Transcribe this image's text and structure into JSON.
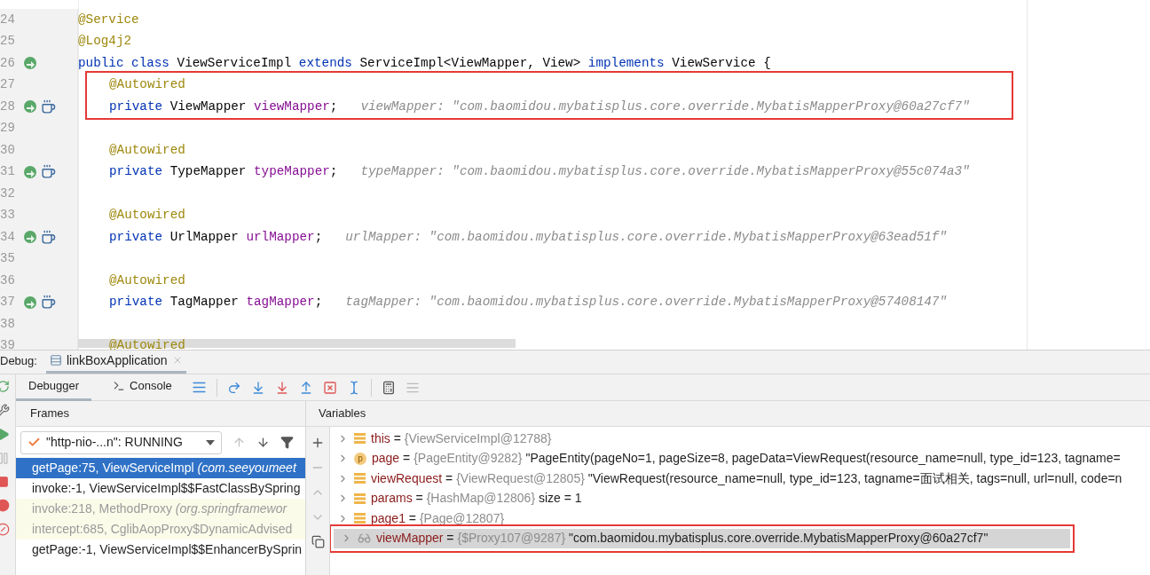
{
  "editor": {
    "lines": [
      {
        "number": "24",
        "indented": false,
        "bean": false,
        "java": false,
        "code": [
          {
            "text": "@Service",
            "kind": "annotation"
          }
        ]
      },
      {
        "number": "25",
        "indented": false,
        "bean": false,
        "java": false,
        "code": [
          {
            "text": "@Log4j2",
            "kind": "annotation"
          }
        ]
      },
      {
        "number": "26",
        "indented": false,
        "bean": true,
        "java": false,
        "code": [
          {
            "text": "public class ",
            "kind": "keyword"
          },
          {
            "text": "ViewServiceImpl ",
            "kind": "plain"
          },
          {
            "text": "extends ",
            "kind": "keyword"
          },
          {
            "text": "ServiceImpl<ViewMapper, View> ",
            "kind": "plain"
          },
          {
            "text": "implements ",
            "kind": "keyword"
          },
          {
            "text": "ViewService {",
            "kind": "plain"
          }
        ]
      }
    ],
    "highlighted_lines": [
      {
        "number": "27",
        "indented": true,
        "bean": false,
        "java": false,
        "code": [
          {
            "text": "@Autowired",
            "kind": "annotation"
          }
        ]
      },
      {
        "number": "28",
        "indented": true,
        "bean": true,
        "java": true,
        "code": [
          {
            "text": "private ",
            "kind": "keyword"
          },
          {
            "text": "ViewMapper ",
            "kind": "plain"
          },
          {
            "text": "viewMapper",
            "kind": "field"
          },
          {
            "text": ";",
            "kind": "plain"
          }
        ],
        "hint": "viewMapper: \"com.baomidou.mybatisplus.core.override.MybatisMapperProxy@60a27cf7\""
      }
    ],
    "more_lines": [
      {
        "number": "29",
        "bean": false,
        "java": false
      },
      {
        "number": "30",
        "indented": true,
        "bean": false,
        "java": false,
        "code": [
          {
            "text": "@Autowired",
            "kind": "annotation"
          }
        ]
      },
      {
        "number": "31",
        "indented": true,
        "bean": true,
        "java": true,
        "code": [
          {
            "text": "private ",
            "kind": "keyword"
          },
          {
            "text": "TypeMapper ",
            "kind": "plain"
          },
          {
            "text": "typeMapper",
            "kind": "field"
          },
          {
            "text": ";",
            "kind": "plain"
          }
        ],
        "hint": "typeMapper: \"com.baomidou.mybatisplus.core.override.MybatisMapperProxy@55c074a3\""
      },
      {
        "number": "32",
        "bean": false,
        "java": false
      },
      {
        "number": "33",
        "indented": true,
        "bean": false,
        "java": false,
        "code": [
          {
            "text": "@Autowired",
            "kind": "annotation"
          }
        ]
      },
      {
        "number": "34",
        "indented": true,
        "bean": true,
        "java": true,
        "code": [
          {
            "text": "private ",
            "kind": "keyword"
          },
          {
            "text": "UrlMapper ",
            "kind": "plain"
          },
          {
            "text": "urlMapper",
            "kind": "field"
          },
          {
            "text": ";",
            "kind": "plain"
          }
        ],
        "hint": "urlMapper: \"com.baomidou.mybatisplus.core.override.MybatisMapperProxy@63ead51f\""
      },
      {
        "number": "35",
        "bean": false,
        "java": false
      },
      {
        "number": "36",
        "indented": true,
        "bean": false,
        "java": false,
        "code": [
          {
            "text": "@Autowired",
            "kind": "annotation"
          }
        ]
      },
      {
        "number": "37",
        "indented": true,
        "bean": true,
        "java": true,
        "code": [
          {
            "text": "private ",
            "kind": "keyword"
          },
          {
            "text": "TagMapper ",
            "kind": "plain"
          },
          {
            "text": "tagMapper",
            "kind": "field"
          },
          {
            "text": ";",
            "kind": "plain"
          }
        ],
        "hint": "tagMapper: \"com.baomidou.mybatisplus.core.override.MybatisMapperProxy@57408147\""
      },
      {
        "number": "38",
        "bean": false,
        "java": false
      },
      {
        "number": "39",
        "indented": true,
        "bean": false,
        "java": false,
        "code": [
          {
            "text": "@Autowired",
            "kind": "annotation"
          }
        ]
      }
    ]
  },
  "debug": {
    "label": "Debug:",
    "session": "linkBoxApplication",
    "tabs": [
      {
        "label": "Debugger",
        "selected": true
      },
      {
        "label": "Console",
        "selected": false
      }
    ],
    "frames": {
      "title": "Frames",
      "thread": "\"http-nio-...n\": RUNNING",
      "items": [
        {
          "text": "getPage:75, ViewServiceImpl",
          "location": "(com.seeyoumeet",
          "selected": true,
          "library": false
        },
        {
          "text": "invoke:-1, ViewServiceImpl$$FastClassBySpring",
          "selected": false,
          "library": false
        },
        {
          "text": "invoke:218, MethodProxy",
          "location": "(org.springframewor",
          "selected": false,
          "library": true
        },
        {
          "text": "intercept:685, CglibAopProxy$DynamicAdvised",
          "selected": false,
          "library": true
        },
        {
          "text": "getPage:-1, ViewServiceImpl$$EnhancerBySprin",
          "selected": false,
          "library": false
        }
      ]
    },
    "variables": {
      "title": "Variables",
      "items": [
        {
          "kind": "field",
          "name": "this",
          "operator": "=",
          "ref": "{ViewServiceImpl@12788}",
          "selected": false,
          "highlighted": false
        },
        {
          "kind": "param",
          "badge": "p",
          "name": "page",
          "operator": "=",
          "ref": "{PageEntity@9282}",
          "value": "\"PageEntity(pageNo=1, pageSize=8, pageData=ViewRequest(resource_name=null, type_id=123, tagname=",
          "selected": false,
          "highlighted": false
        },
        {
          "kind": "field",
          "name": "viewRequest",
          "operator": "=",
          "ref": "{ViewRequest@12805}",
          "value": "\"ViewRequest(resource_name=null, type_id=123, tagname=面试相关, tags=null, url=null, code=n",
          "selected": false,
          "highlighted": false
        },
        {
          "kind": "field",
          "name": "params",
          "operator": "=",
          "ref": "{HashMap@12806}",
          "value": "size = 1",
          "selected": false,
          "highlighted": false
        },
        {
          "kind": "field",
          "name": "page1",
          "operator": "=",
          "ref": "{Page@12807}",
          "selected": false,
          "highlighted": false
        },
        {
          "kind": "watch",
          "name": "viewMapper",
          "operator": "=",
          "ref": "{$Proxy107@9287}",
          "value": "\"com.baomidou.mybatisplus.core.override.MybatisMapperProxy@60a27cf7\"",
          "selected": true,
          "highlighted": true
        }
      ]
    }
  }
}
